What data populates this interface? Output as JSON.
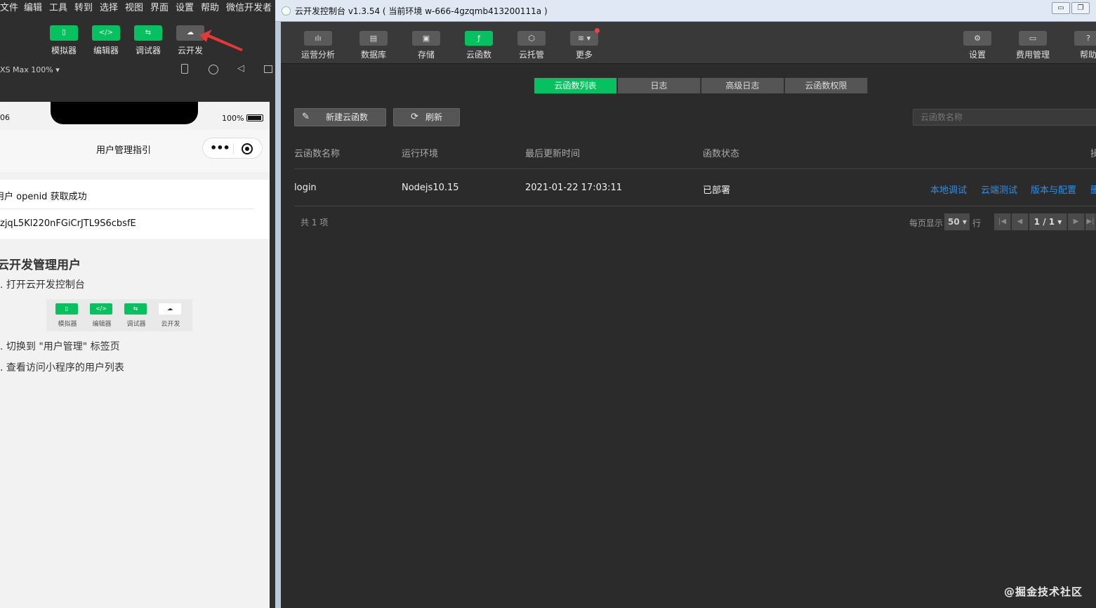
{
  "ide": {
    "menu": [
      "文件",
      "编辑",
      "工具",
      "转到",
      "选择",
      "视图",
      "界面",
      "设置",
      "帮助",
      "微信开发者"
    ],
    "toolbar": [
      {
        "label": "模拟器",
        "icon": "phone-icon",
        "glyph": "▯",
        "active": true
      },
      {
        "label": "编辑器",
        "icon": "code-icon",
        "glyph": "</>",
        "active": true
      },
      {
        "label": "调试器",
        "icon": "debug-icon",
        "glyph": "⇆",
        "active": true
      },
      {
        "label": "云开发",
        "icon": "cloud-icon",
        "glyph": "☁",
        "active": false
      }
    ],
    "device_select": "XS Max 100% ▾",
    "phone": {
      "time": "06",
      "battery": "100%",
      "nav_title": "用户管理指引",
      "openid_msg": "用户 openid 获取成功",
      "openid_value": "zjqL5Kl220nFGiCrJTL9S6cbsfE",
      "guide_title": "云开发管理用户",
      "steps": [
        ". 打开云开发控制台",
        ". 切换到 \"用户管理\" 标签页",
        ". 查看访问小程序的用户列表"
      ],
      "mini_tools": [
        {
          "label": "模拟器",
          "glyph": "▯"
        },
        {
          "label": "编辑器",
          "glyph": "</>"
        },
        {
          "label": "调试器",
          "glyph": "⇆"
        },
        {
          "label": "云开发",
          "glyph": "☁"
        }
      ]
    }
  },
  "console": {
    "title": "云开发控制台 v1.3.54 ( 当前环境 w-666-4gzqmb413200111a )",
    "win_controls": [
      "▭",
      "❐"
    ],
    "nav": [
      {
        "label": "运营分析",
        "icon": "chart-icon",
        "glyph": "ılı",
        "active": false
      },
      {
        "label": "数据库",
        "icon": "database-icon",
        "glyph": "▤",
        "active": false
      },
      {
        "label": "存储",
        "icon": "storage-icon",
        "glyph": "▣",
        "active": false
      },
      {
        "label": "云函数",
        "icon": "function-icon",
        "glyph": "ƒ",
        "active": true
      },
      {
        "label": "云托管",
        "icon": "container-icon",
        "glyph": "⬡",
        "active": false
      },
      {
        "label": "更多",
        "icon": "layers-icon",
        "glyph": "≋ ▾",
        "active": false
      }
    ],
    "nav_right": [
      {
        "label": "设置",
        "icon": "gear-icon",
        "glyph": "⚙"
      },
      {
        "label": "费用管理",
        "icon": "billing-icon",
        "glyph": "▭"
      },
      {
        "label": "帮助",
        "icon": "help-icon",
        "glyph": "?"
      }
    ],
    "tabs": [
      "云函数列表",
      "日志",
      "高级日志",
      "云函数权限"
    ],
    "active_tab": 0,
    "actions": {
      "new_label": "新建云函数",
      "refresh_label": "刷新"
    },
    "search_placeholder": "云函数名称",
    "table": {
      "headers": [
        "云函数名称",
        "运行环境",
        "最后更新时间",
        "函数状态",
        "操"
      ],
      "rows": [
        {
          "name": "login",
          "runtime": "Nodejs10.15",
          "updated": "2021-01-22 17:03:11",
          "status": "已部署",
          "ops": [
            "本地调试",
            "云端测试",
            "版本与配置",
            "删"
          ]
        }
      ]
    },
    "footer": {
      "total": "共 1 项",
      "per_page_label": "每页显示",
      "per_page": "50 ▾",
      "rows_suffix": "行",
      "page": "1 / 1 ▾"
    }
  },
  "watermark": "@掘金技术社区",
  "colors": {
    "accent": "#07c160",
    "link": "#2e8fe8",
    "bg": "#2b2b2b"
  }
}
